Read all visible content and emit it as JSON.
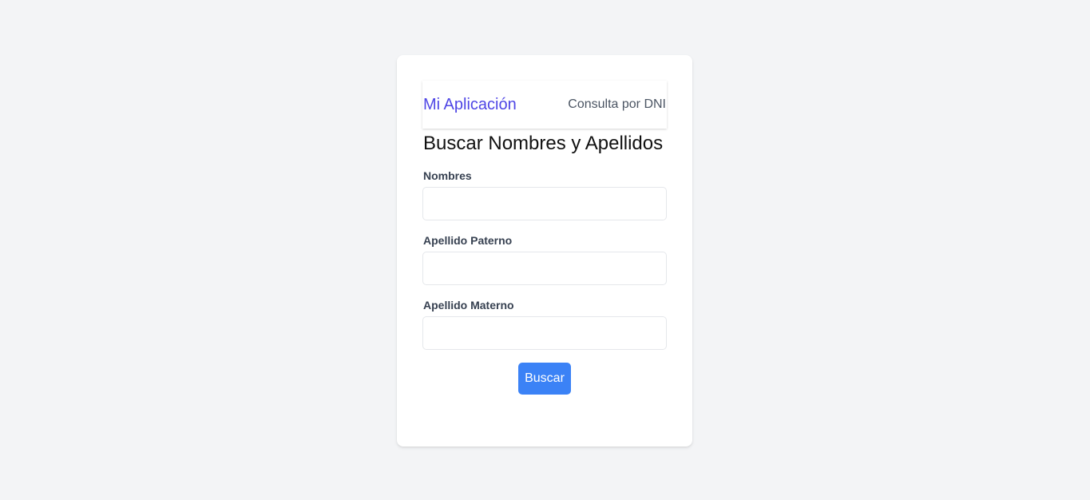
{
  "navbar": {
    "brand": "Mi Aplicación",
    "link": "Consulta por DNI"
  },
  "form": {
    "title": "Buscar Nombres y Apellidos",
    "fields": [
      {
        "label": "Nombres",
        "value": "",
        "placeholder": ""
      },
      {
        "label": "Apellido Paterno",
        "value": "",
        "placeholder": ""
      },
      {
        "label": "Apellido Materno",
        "value": "",
        "placeholder": ""
      }
    ],
    "submit_label": "Buscar"
  },
  "colors": {
    "brand": "#4f46e5",
    "button": "#3b82f6",
    "background": "#f3f4f6"
  }
}
